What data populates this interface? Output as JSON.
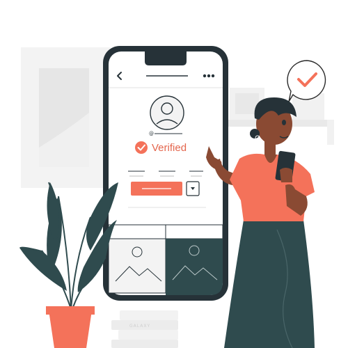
{
  "profile": {
    "handle_prefix": "@",
    "status_label": "Verified"
  },
  "icons": {
    "back": "chevron-left-icon",
    "menu": "more-dots-icon",
    "avatar": "user-avatar-icon",
    "verified": "checkmark-badge-icon",
    "speech": "checkmark-speech-bubble-icon",
    "dropdown": "chevron-down-icon",
    "photo": "image-placeholder-icon"
  },
  "books": {
    "spine_label": "GALAXY"
  },
  "colors": {
    "accent": "#f4725a",
    "dark": "#2f4b4e",
    "skin": "#8a4a33",
    "light_gray": "#f2f2f2"
  }
}
